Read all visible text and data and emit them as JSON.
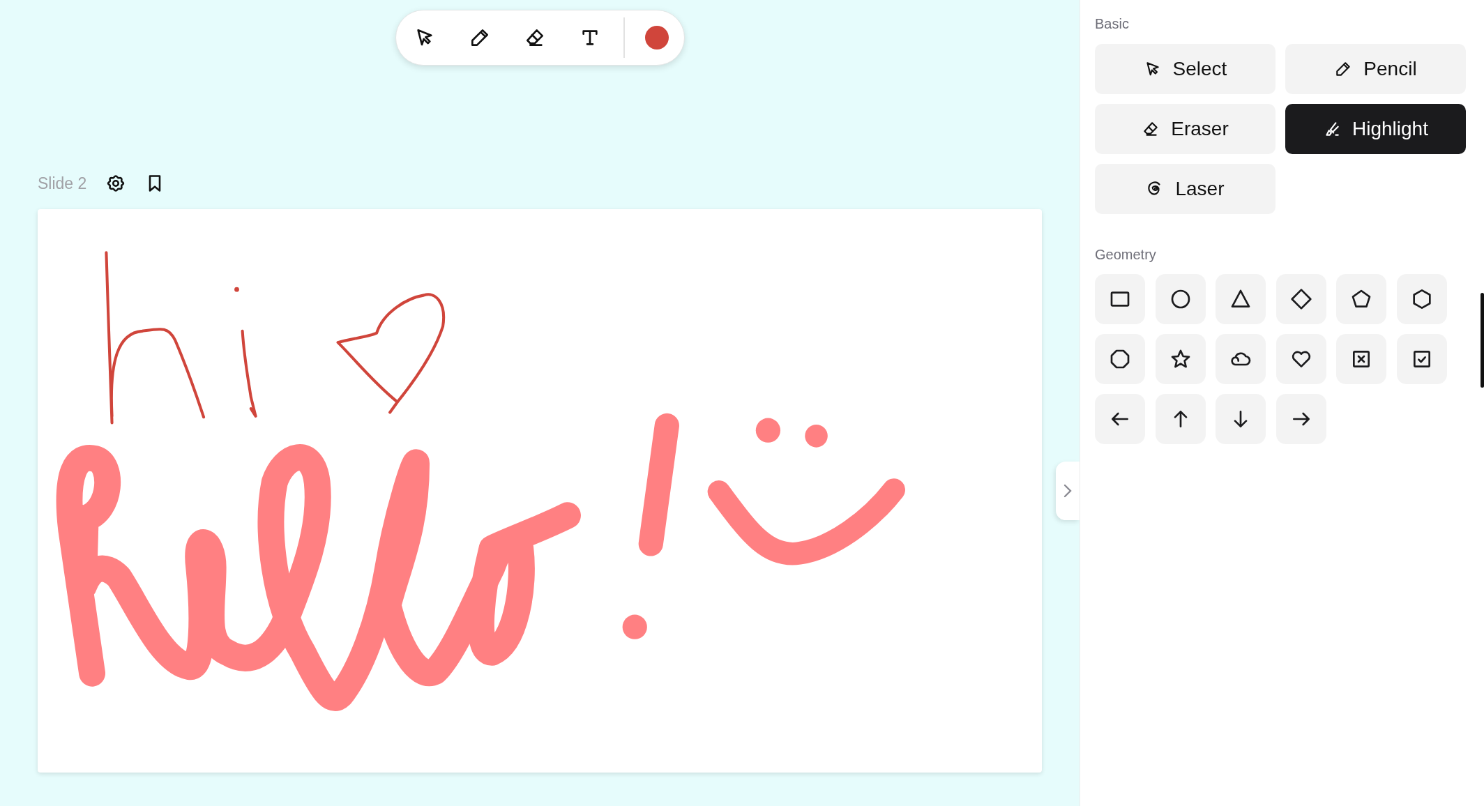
{
  "toolbar": {
    "tools": [
      {
        "kind": "select"
      },
      {
        "kind": "pencil"
      },
      {
        "kind": "eraser"
      },
      {
        "kind": "text"
      }
    ],
    "swatch": {
      "color": "#d0453b"
    }
  },
  "slide": {
    "label": "Slide 2"
  },
  "panel": {
    "basic": {
      "title": "Basic",
      "tools": [
        {
          "kind": "select",
          "label": "Select",
          "selected": false
        },
        {
          "kind": "pencil",
          "label": "Pencil",
          "selected": false
        },
        {
          "kind": "eraser",
          "label": "Eraser",
          "selected": false
        },
        {
          "kind": "highlight",
          "label": "Highlight",
          "selected": true
        },
        {
          "kind": "laser",
          "label": "Laser",
          "selected": false
        }
      ]
    },
    "geometry": {
      "title": "Geometry",
      "shapes": [
        {
          "kind": "rectangle"
        },
        {
          "kind": "circle"
        },
        {
          "kind": "triangle"
        },
        {
          "kind": "diamond"
        },
        {
          "kind": "pentagon"
        },
        {
          "kind": "hexagon"
        },
        {
          "kind": "octagon"
        },
        {
          "kind": "star"
        },
        {
          "kind": "cloud"
        },
        {
          "kind": "heart"
        },
        {
          "kind": "x-box"
        },
        {
          "kind": "check-box"
        },
        {
          "kind": "arrow-left"
        },
        {
          "kind": "arrow-up"
        },
        {
          "kind": "arrow-down"
        },
        {
          "kind": "arrow-right"
        }
      ]
    }
  }
}
